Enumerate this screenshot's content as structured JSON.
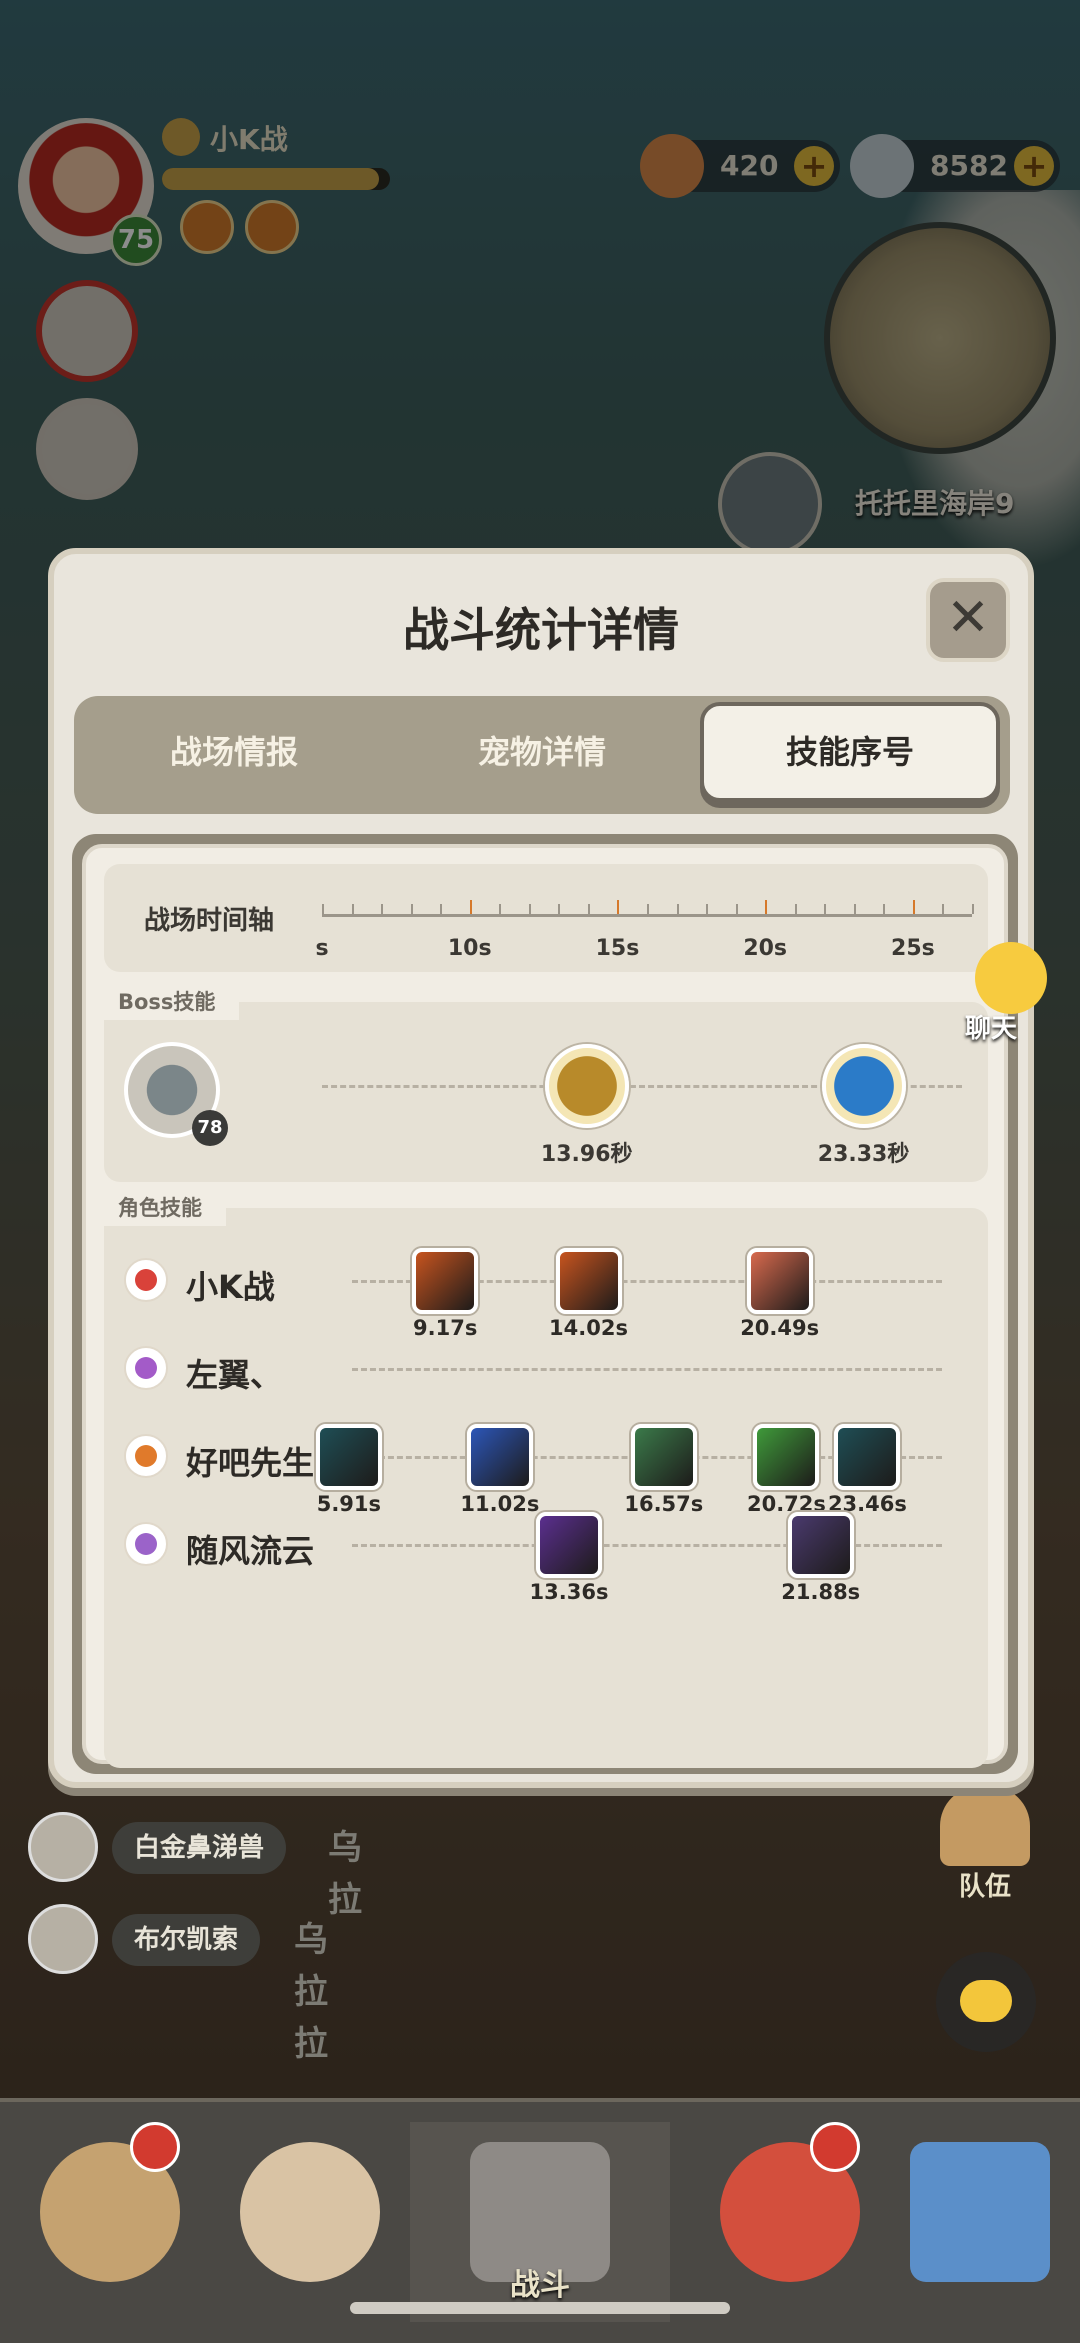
{
  "hud": {
    "player_name": "小K战",
    "player_level": "75",
    "xp_fraction": 0.95,
    "coins": "420",
    "gems": "8582",
    "map_location": "托托里海岸9"
  },
  "chat": {
    "bubble_label": "聊天",
    "messages": [
      {
        "name": "白金鼻涕兽",
        "text": "乌拉"
      },
      {
        "name": "布尔凯索",
        "text": "乌拉拉"
      }
    ]
  },
  "side": {
    "team_label": "队伍"
  },
  "bottom_nav": {
    "battle_label": "战斗"
  },
  "modal": {
    "title": "战斗统计详情",
    "close_symbol": "✕",
    "tabs": [
      {
        "label": "战场情报",
        "active": false
      },
      {
        "label": "宠物详情",
        "active": false
      },
      {
        "label": "技能序号",
        "active": true
      }
    ],
    "timeline": {
      "label": "战场时间轴",
      "ticks": [
        "s",
        "10s",
        "15s",
        "20s",
        "25s"
      ]
    },
    "boss": {
      "section_label": "Boss技能",
      "level": "78",
      "skills": [
        {
          "time": "13.96秒",
          "t": 13.96,
          "color": "#b88a2a"
        },
        {
          "time": "23.33秒",
          "t": 23.33,
          "color": "#2b7bc8"
        }
      ]
    },
    "characters": {
      "section_label": "角色技能",
      "rows": [
        {
          "name": "小K战",
          "icon_color": "#d9423a",
          "skills": [
            {
              "time": "9.17s",
              "t": 9.17,
              "color": "#c7541f"
            },
            {
              "time": "14.02s",
              "t": 14.02,
              "color": "#c7541f"
            },
            {
              "time": "20.49s",
              "t": 20.49,
              "color": "#d86a4e"
            }
          ]
        },
        {
          "name": "左翼、",
          "icon_color": "#a35bc8",
          "skills": []
        },
        {
          "name": "好吧先生",
          "icon_color": "#e07a2b",
          "skills": [
            {
              "time": "5.91s",
              "t": 5.91,
              "color": "#1f4e55"
            },
            {
              "time": "11.02s",
              "t": 11.02,
              "color": "#2c56b8"
            },
            {
              "time": "16.57s",
              "t": 16.57,
              "color": "#3b7a4a"
            },
            {
              "time": "20.72s",
              "t": 20.72,
              "color": "#3f9a3a"
            },
            {
              "time": "23.46s",
              "t": 23.46,
              "color": "#1f4e55"
            }
          ]
        },
        {
          "name": "随风流云",
          "icon_color": "#9b63c9",
          "skills": [
            {
              "time": "13.36s",
              "t": 13.36,
              "color": "#5b2f8f"
            },
            {
              "time": "21.88s",
              "t": 21.88,
              "color": "#4a3a6e"
            }
          ]
        }
      ]
    }
  }
}
